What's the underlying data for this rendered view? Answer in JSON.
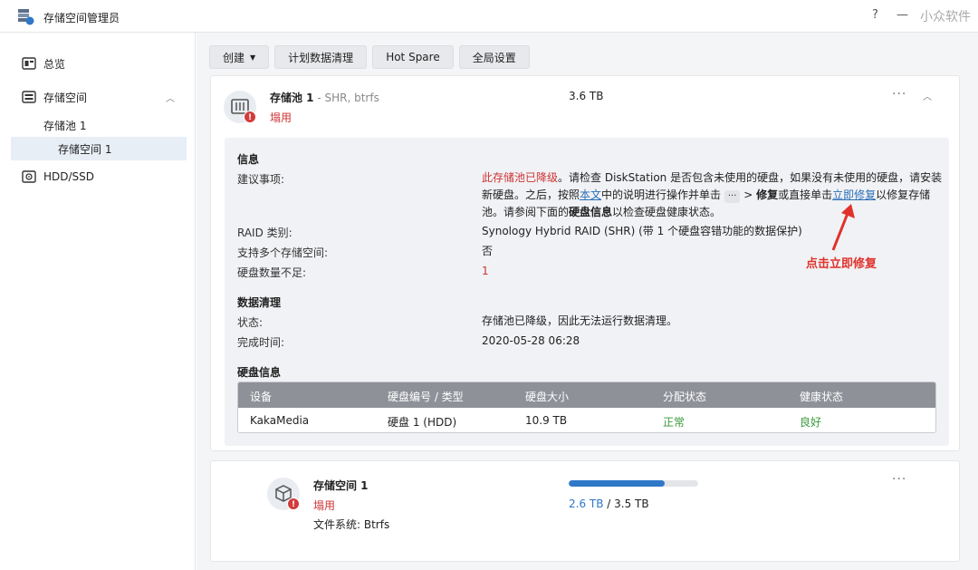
{
  "window": {
    "title": "存储空间管理员",
    "help": "?",
    "minimize": "—",
    "watermark": "小众软件"
  },
  "sidebar": {
    "items": [
      {
        "label": "总览",
        "icon": "overview-icon"
      },
      {
        "label": "存储空间",
        "icon": "storage-icon"
      },
      {
        "label": "存储池 1"
      },
      {
        "label": "存储空间 1"
      },
      {
        "label": "HDD/SSD",
        "icon": "hdd-icon"
      }
    ]
  },
  "toolbar": {
    "create": "创建",
    "schedule": "计划数据清理",
    "hotspare": "Hot Spare",
    "settings": "全局设置"
  },
  "pool": {
    "name": "存储池 1",
    "subtitle": " - SHR, btrfs",
    "status": "塌用",
    "size": "3.6 TB",
    "badge": "!"
  },
  "info": {
    "title": "信息",
    "advice_label": "建议事项:",
    "advice_red": "此存储池已降级",
    "advice_1": "。请检查 DiskStation 是否包含未使用的硬盘，如果没有未使用的硬盘，请安装新硬盘。之后，按照",
    "advice_link1": "本文",
    "advice_2": "中的说明进行操作并单击 ",
    "advice_dots": "···",
    "advice_3": " > ",
    "advice_bold1": "修复",
    "advice_4": "或直接单击",
    "advice_link2": "立即修复",
    "advice_5": "以修复存储池。请参阅下面的",
    "advice_bold2": "硬盘信息",
    "advice_6": "以检查硬盘健康状态。",
    "raid_label": "RAID 类别:",
    "raid_value": "Synology Hybrid RAID (SHR) (带 1 个硬盘容错功能的数据保护)",
    "multi_label": "支持多个存储空间:",
    "multi_value": "否",
    "missing_label": "硬盘数量不足:",
    "missing_value": "1",
    "annotation": "点击立即修复"
  },
  "scrub": {
    "title": "数据清理",
    "status_label": "状态:",
    "status_value": "存储池已降级，因此无法运行数据清理。",
    "time_label": "完成时间:",
    "time_value": "2020-05-28 06:28"
  },
  "disks": {
    "title": "硬盘信息",
    "headers": [
      "设备",
      "硬盘编号 / 类型",
      "硬盘大小",
      "分配状态",
      "健康状态"
    ],
    "rows": [
      [
        "KakaMedia",
        "硬盘 1 (HDD)",
        "10.9 TB",
        "正常",
        "良好"
      ]
    ]
  },
  "volume": {
    "name": "存储空间 1",
    "status": "塌用",
    "filesystem": "文件系统: Btrfs",
    "used": "2.6 TB",
    "separator": " / ",
    "total": "3.5 TB",
    "usage_fraction": 0.74,
    "badge": "!"
  },
  "more_icon": "···",
  "collapse_icon": "︿",
  "colors": {
    "accent": "#2f78c8",
    "danger": "#c33333",
    "healthy": "#3a9a3a",
    "annotation": "#e0322b"
  }
}
